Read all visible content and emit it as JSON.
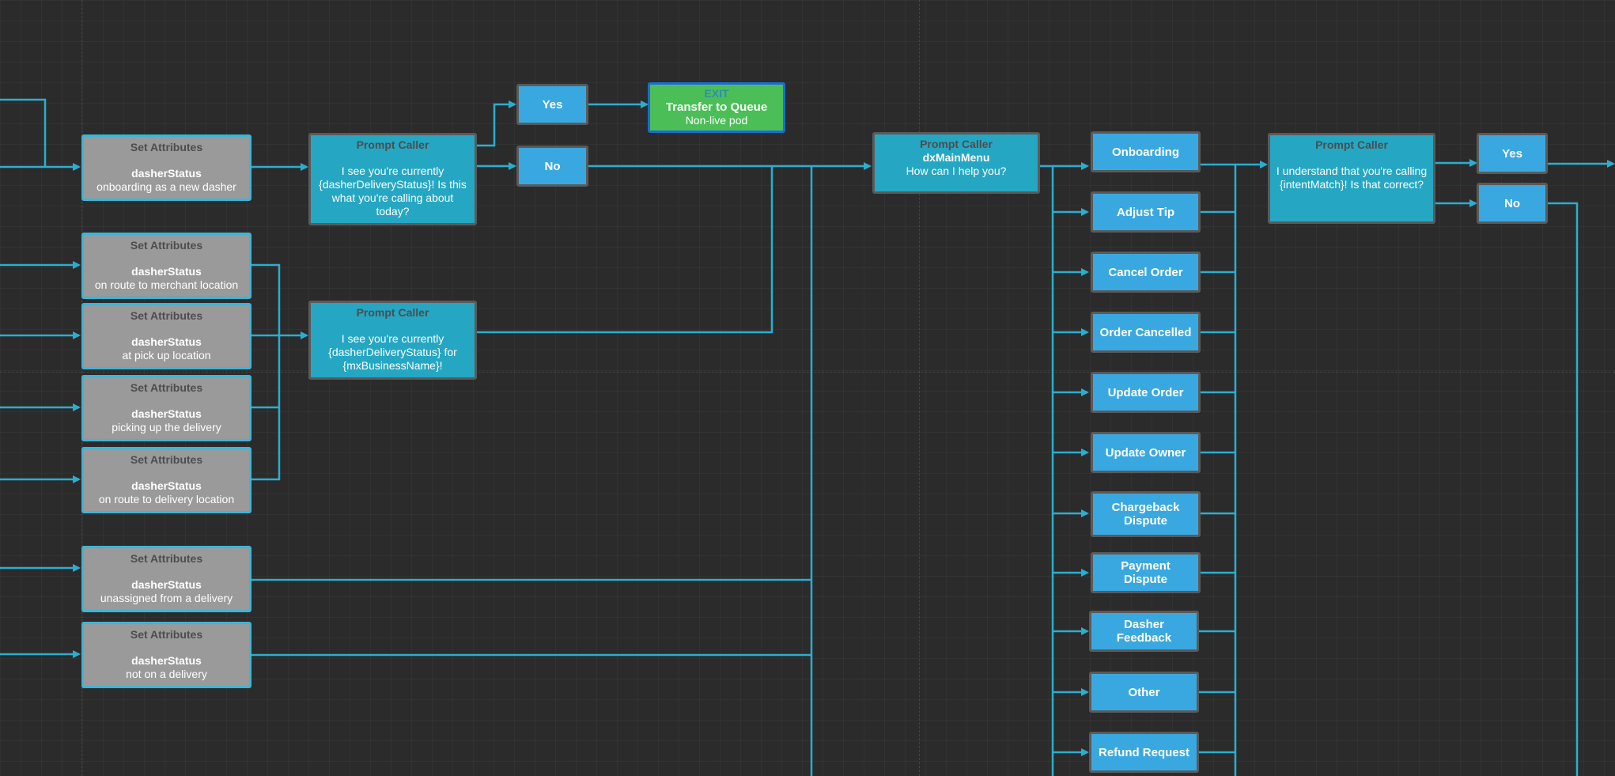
{
  "colors": {
    "canvas_bg": "#2b2b2b",
    "connector": "#2aaed0",
    "set_attributes_fill": "#9a9a9a",
    "prompt_fill": "#25a7c3",
    "option_fill": "#3aa8e0",
    "exit_fill": "#4cbe57",
    "exit_border": "#1a6cd6"
  },
  "set_attributes": [
    {
      "header": "Set Attributes",
      "key": "dasherStatus",
      "value": "onboarding as a new dasher"
    },
    {
      "header": "Set Attributes",
      "key": "dasherStatus",
      "value": "on route to merchant location"
    },
    {
      "header": "Set Attributes",
      "key": "dasherStatus",
      "value": "at pick up location"
    },
    {
      "header": "Set Attributes",
      "key": "dasherStatus",
      "value": "picking up the delivery"
    },
    {
      "header": "Set Attributes",
      "key": "dasherStatus",
      "value": "on route to delivery location"
    },
    {
      "header": "Set Attributes",
      "key": "dasherStatus",
      "value": "unassigned from a delivery"
    },
    {
      "header": "Set Attributes",
      "key": "dasherStatus",
      "value": "not on a delivery"
    }
  ],
  "prompts": {
    "confirm_status": {
      "header": "Prompt Caller",
      "text": "I see you're currently {dasherDeliveryStatus}! Is this what you're calling about today?"
    },
    "status_business": {
      "header": "Prompt Caller",
      "text": "I see you're currently {dasherDeliveryStatus} for {mxBusinessName}!"
    },
    "main_menu": {
      "header": "Prompt Caller",
      "name": "dxMainMenu",
      "text": "How can I help you?"
    },
    "confirm_intent": {
      "header": "Prompt Caller",
      "text": "I understand that you're calling {intentMatch}! Is that correct?"
    }
  },
  "branches": {
    "first": {
      "yes": "Yes",
      "no": "No"
    },
    "second": {
      "yes": "Yes",
      "no": "No"
    }
  },
  "exit": {
    "header": "EXIT",
    "title": "Transfer to Queue",
    "subtitle": "Non-live pod"
  },
  "menu_options": [
    "Onboarding",
    "Adjust Tip",
    "Cancel Order",
    "Order Cancelled",
    "Update Order",
    "Update Owner",
    "Chargeback Dispute",
    "Payment Dispute",
    "Dasher Feedback",
    "Other",
    "Refund Request"
  ]
}
